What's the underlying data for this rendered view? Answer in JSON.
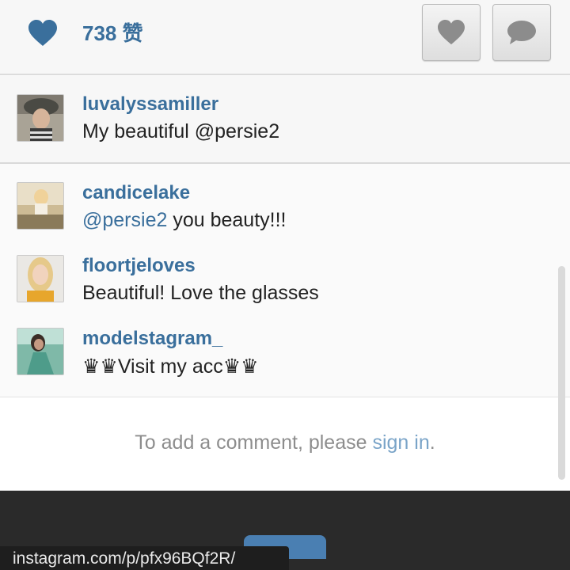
{
  "likes": {
    "count_label": "738 赞"
  },
  "actions": {
    "like_icon": "heart-icon",
    "comment_icon": "speech-bubble-icon"
  },
  "caption": {
    "username": "luvalyssamiller",
    "text": "My beautiful @persie2"
  },
  "comments": [
    {
      "username": "candicelake",
      "mention": "@persie2",
      "text": " you beauty!!!"
    },
    {
      "username": "floortjeloves",
      "text": "Beautiful! Love the glasses"
    },
    {
      "username": "modelstagram_",
      "text": "♛♛Visit my acc♛♛"
    }
  ],
  "add_comment": {
    "prefix": "To add a comment, please ",
    "link": "sign in",
    "suffix": "."
  },
  "status_url": "instagram.com/p/pfx96BQf2R/",
  "colors": {
    "username": "#3a6f9c",
    "link": "#7aa4c8",
    "heart": "#3a6f9c"
  }
}
